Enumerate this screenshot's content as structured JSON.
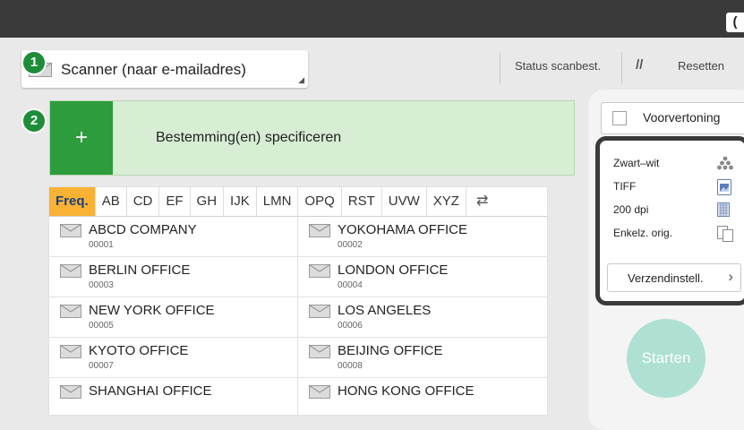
{
  "header": {
    "function_label": "Scanner (naar e-mailadres)",
    "status_label": "Status scanbest.",
    "reset_label": "Resetten",
    "top_right_glyph": "("
  },
  "badges": {
    "one": "1",
    "two": "2"
  },
  "destination": {
    "plus": "+",
    "label": "Bestemming(en) specificeren"
  },
  "tabs": [
    "Freq.",
    "AB",
    "CD",
    "EF",
    "GH",
    "IJK",
    "LMN",
    "OPQ",
    "RST",
    "UVW",
    "XYZ"
  ],
  "tab_cycle_glyph": "⇄",
  "entries": [
    {
      "name": "ABCD COMPANY",
      "num": "00001"
    },
    {
      "name": "YOKOHAMA OFFICE",
      "num": "00002"
    },
    {
      "name": "BERLIN OFFICE",
      "num": "00003"
    },
    {
      "name": "LONDON OFFICE",
      "num": "00004"
    },
    {
      "name": "NEW YORK OFFICE",
      "num": "00005"
    },
    {
      "name": "LOS ANGELES",
      "num": "00006"
    },
    {
      "name": "KYOTO OFFICE",
      "num": "00007"
    },
    {
      "name": "BEIJING OFFICE",
      "num": "00008"
    },
    {
      "name": "SHANGHAI  OFFICE",
      "num": ""
    },
    {
      "name": "HONG KONG OFFICE",
      "num": ""
    }
  ],
  "preview": {
    "label": "Voorvertoning"
  },
  "settings": {
    "color": "Zwart–wit",
    "format": "TIFF",
    "resolution": "200 dpi",
    "original": "Enkelz. orig.",
    "send_label": "Verzendinstell.",
    "send_arrow": "›"
  },
  "start_label": "Starten",
  "colors": {
    "topbar": "#3a3a3a",
    "accent_green": "#2d9c3c",
    "badge_green": "#1e8d3a",
    "dest_bg": "#d7edd4",
    "active_tab": "#f9b233",
    "start_btn": "#aee0d3"
  }
}
